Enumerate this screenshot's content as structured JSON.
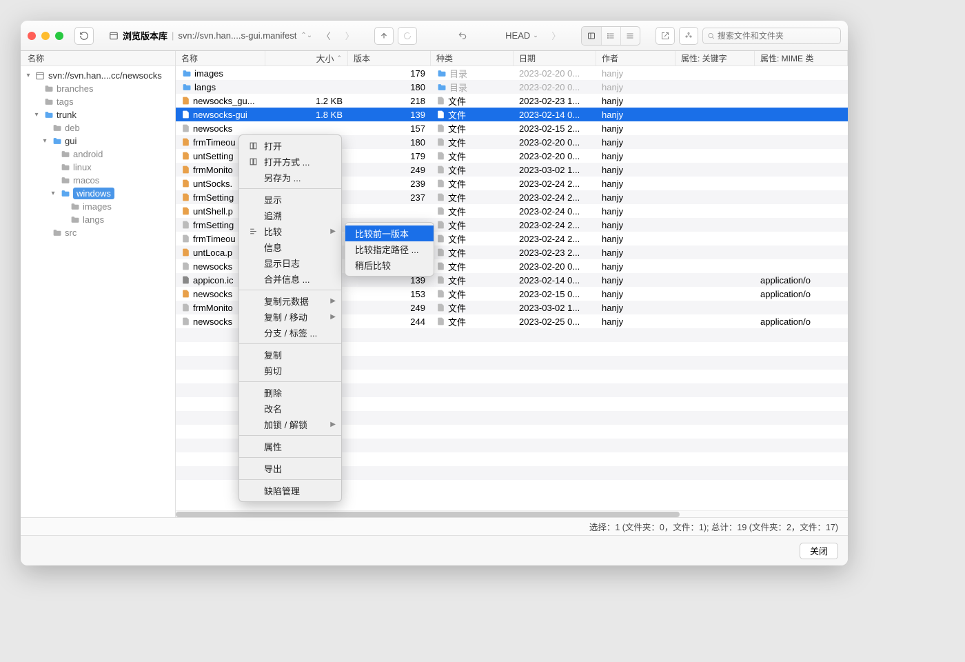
{
  "toolbar": {
    "browse_label": "浏览版本库",
    "path": "svn://svn.han....s-gui.manifest",
    "head": "HEAD",
    "search_placeholder": "搜索文件和文件夹"
  },
  "sidebar": {
    "header": "名称",
    "nodes": [
      {
        "level": 0,
        "arrow": "▾",
        "icon": "repo",
        "label": "svn://svn.han....cc/newsocks"
      },
      {
        "level": 1,
        "arrow": "",
        "icon": "folder-grey",
        "label": "branches"
      },
      {
        "level": 1,
        "arrow": "",
        "icon": "folder-grey",
        "label": "tags"
      },
      {
        "level": 1,
        "arrow": "▾",
        "icon": "folder",
        "label": "trunk"
      },
      {
        "level": 2,
        "arrow": "",
        "icon": "folder-grey",
        "label": "deb"
      },
      {
        "level": 2,
        "arrow": "▾",
        "icon": "folder",
        "label": "gui"
      },
      {
        "level": 3,
        "arrow": "",
        "icon": "folder-grey",
        "label": "android"
      },
      {
        "level": 3,
        "arrow": "",
        "icon": "folder-grey",
        "label": "linux"
      },
      {
        "level": 3,
        "arrow": "",
        "icon": "folder-grey",
        "label": "macos"
      },
      {
        "level": 3,
        "arrow": "▾",
        "icon": "folder",
        "label": "windows",
        "sel": true
      },
      {
        "level": 4,
        "arrow": "",
        "icon": "folder-grey",
        "label": "images"
      },
      {
        "level": 4,
        "arrow": "",
        "icon": "folder-grey",
        "label": "langs"
      },
      {
        "level": 2,
        "arrow": "",
        "icon": "folder-grey",
        "label": "src"
      }
    ]
  },
  "columns": {
    "name": "名称",
    "size": "大小",
    "rev": "版本",
    "kind": "种类",
    "date": "日期",
    "author": "作者",
    "key": "属性: 关键字",
    "mime": "属性: MIME 类"
  },
  "rows": [
    {
      "name": "images",
      "size": "",
      "rev": "179",
      "kind": "目录",
      "kind_muted": true,
      "date": "2023-02-20 0...",
      "date_muted": true,
      "author": "hanjy",
      "auth_muted": true,
      "icon": "folder"
    },
    {
      "name": "langs",
      "size": "",
      "rev": "180",
      "kind": "目录",
      "kind_muted": true,
      "date": "2023-02-20 0...",
      "date_muted": true,
      "author": "hanjy",
      "auth_muted": true,
      "icon": "folder"
    },
    {
      "name": "newsocks_gu...",
      "size": "1.2 KB",
      "rev": "218",
      "kind": "文件",
      "date": "2023-02-23 1...",
      "author": "hanjy",
      "icon": "code"
    },
    {
      "name": "newsocks-gui",
      "size": "1.8 KB",
      "rev": "139",
      "kind": "文件",
      "date": "2023-02-14 0...",
      "author": "hanjy",
      "icon": "file",
      "sel": true
    },
    {
      "name": "newsocks",
      "size": "",
      "rev": "157",
      "kind": "文件",
      "date": "2023-02-15 2...",
      "author": "hanjy",
      "icon": "file"
    },
    {
      "name": "frmTimeou",
      "size": "",
      "rev": "180",
      "kind": "文件",
      "date": "2023-02-20 0...",
      "author": "hanjy",
      "icon": "code"
    },
    {
      "name": "untSetting",
      "size": "",
      "rev": "179",
      "kind": "文件",
      "date": "2023-02-20 0...",
      "author": "hanjy",
      "icon": "code"
    },
    {
      "name": "frmMonito",
      "size": "",
      "rev": "249",
      "kind": "文件",
      "date": "2023-03-02 1...",
      "author": "hanjy",
      "icon": "code"
    },
    {
      "name": "untSocks.",
      "size": "",
      "rev": "239",
      "kind": "文件",
      "date": "2023-02-24 2...",
      "author": "hanjy",
      "icon": "code"
    },
    {
      "name": "frmSetting",
      "size": "",
      "rev": "237",
      "kind": "文件",
      "date": "2023-02-24 2...",
      "author": "hanjy",
      "icon": "code"
    },
    {
      "name": "untShell.p",
      "size": "",
      "rev": "",
      "kind": "文件",
      "date": "2023-02-24 0...",
      "author": "hanjy",
      "icon": "code"
    },
    {
      "name": "frmSetting",
      "size": "",
      "rev": "",
      "kind": "文件",
      "date": "2023-02-24 2...",
      "author": "hanjy",
      "icon": "file"
    },
    {
      "name": "frmTimeou",
      "size": "",
      "rev": "",
      "kind": "文件",
      "date": "2023-02-24 2...",
      "author": "hanjy",
      "icon": "file"
    },
    {
      "name": "untLoca.p",
      "size": "",
      "rev": "",
      "kind": "文件",
      "date": "2023-02-23 2...",
      "author": "hanjy",
      "icon": "code"
    },
    {
      "name": "newsocks",
      "size": "",
      "rev": "179",
      "kind": "文件",
      "date": "2023-02-20 0...",
      "author": "hanjy",
      "icon": "file"
    },
    {
      "name": "appicon.ic",
      "size": "",
      "rev": "139",
      "kind": "文件",
      "date": "2023-02-14 0...",
      "author": "hanjy",
      "icon": "img",
      "mime": "application/o"
    },
    {
      "name": "newsocks",
      "size": "",
      "rev": "153",
      "kind": "文件",
      "date": "2023-02-15 0...",
      "author": "hanjy",
      "icon": "code",
      "mime": "application/o"
    },
    {
      "name": "frmMonito",
      "size": "",
      "rev": "249",
      "kind": "文件",
      "date": "2023-03-02 1...",
      "author": "hanjy",
      "icon": "file"
    },
    {
      "name": "newsocks",
      "size": "",
      "rev": "244",
      "kind": "文件",
      "date": "2023-02-25 0...",
      "author": "hanjy",
      "icon": "file",
      "mime": "application/o"
    }
  ],
  "context_menu": {
    "items": [
      {
        "label": "打开",
        "icon": "book"
      },
      {
        "label": "打开方式 ...",
        "icon": "book"
      },
      {
        "label": "另存为 ..."
      },
      {
        "sep": true
      },
      {
        "label": "显示"
      },
      {
        "label": "追溯"
      },
      {
        "label": "比较",
        "icon": "diff",
        "sub": true,
        "hl": false
      },
      {
        "label": "信息"
      },
      {
        "label": "显示日志"
      },
      {
        "label": "合并信息 ..."
      },
      {
        "sep": true
      },
      {
        "label": "复制元数据",
        "sub": true
      },
      {
        "label": "复制 / 移动",
        "sub": true
      },
      {
        "label": "分支 / 标签 ..."
      },
      {
        "sep": true
      },
      {
        "label": "复制"
      },
      {
        "label": "剪切"
      },
      {
        "sep": true
      },
      {
        "label": "删除"
      },
      {
        "label": "改名"
      },
      {
        "label": "加锁 / 解锁",
        "sub": true
      },
      {
        "sep": true
      },
      {
        "label": "属性"
      },
      {
        "sep": true
      },
      {
        "label": "导出"
      },
      {
        "sep": true
      },
      {
        "label": "缺陷管理"
      }
    ]
  },
  "submenu": {
    "items": [
      {
        "label": "比较前一版本",
        "hl": true
      },
      {
        "label": "比较指定路径 ..."
      },
      {
        "label": "稍后比较"
      }
    ]
  },
  "status": "选择：1 (文件夹：0，文件：1); 总计：19 (文件夹：2，文件：17)",
  "close_label": "关闭"
}
